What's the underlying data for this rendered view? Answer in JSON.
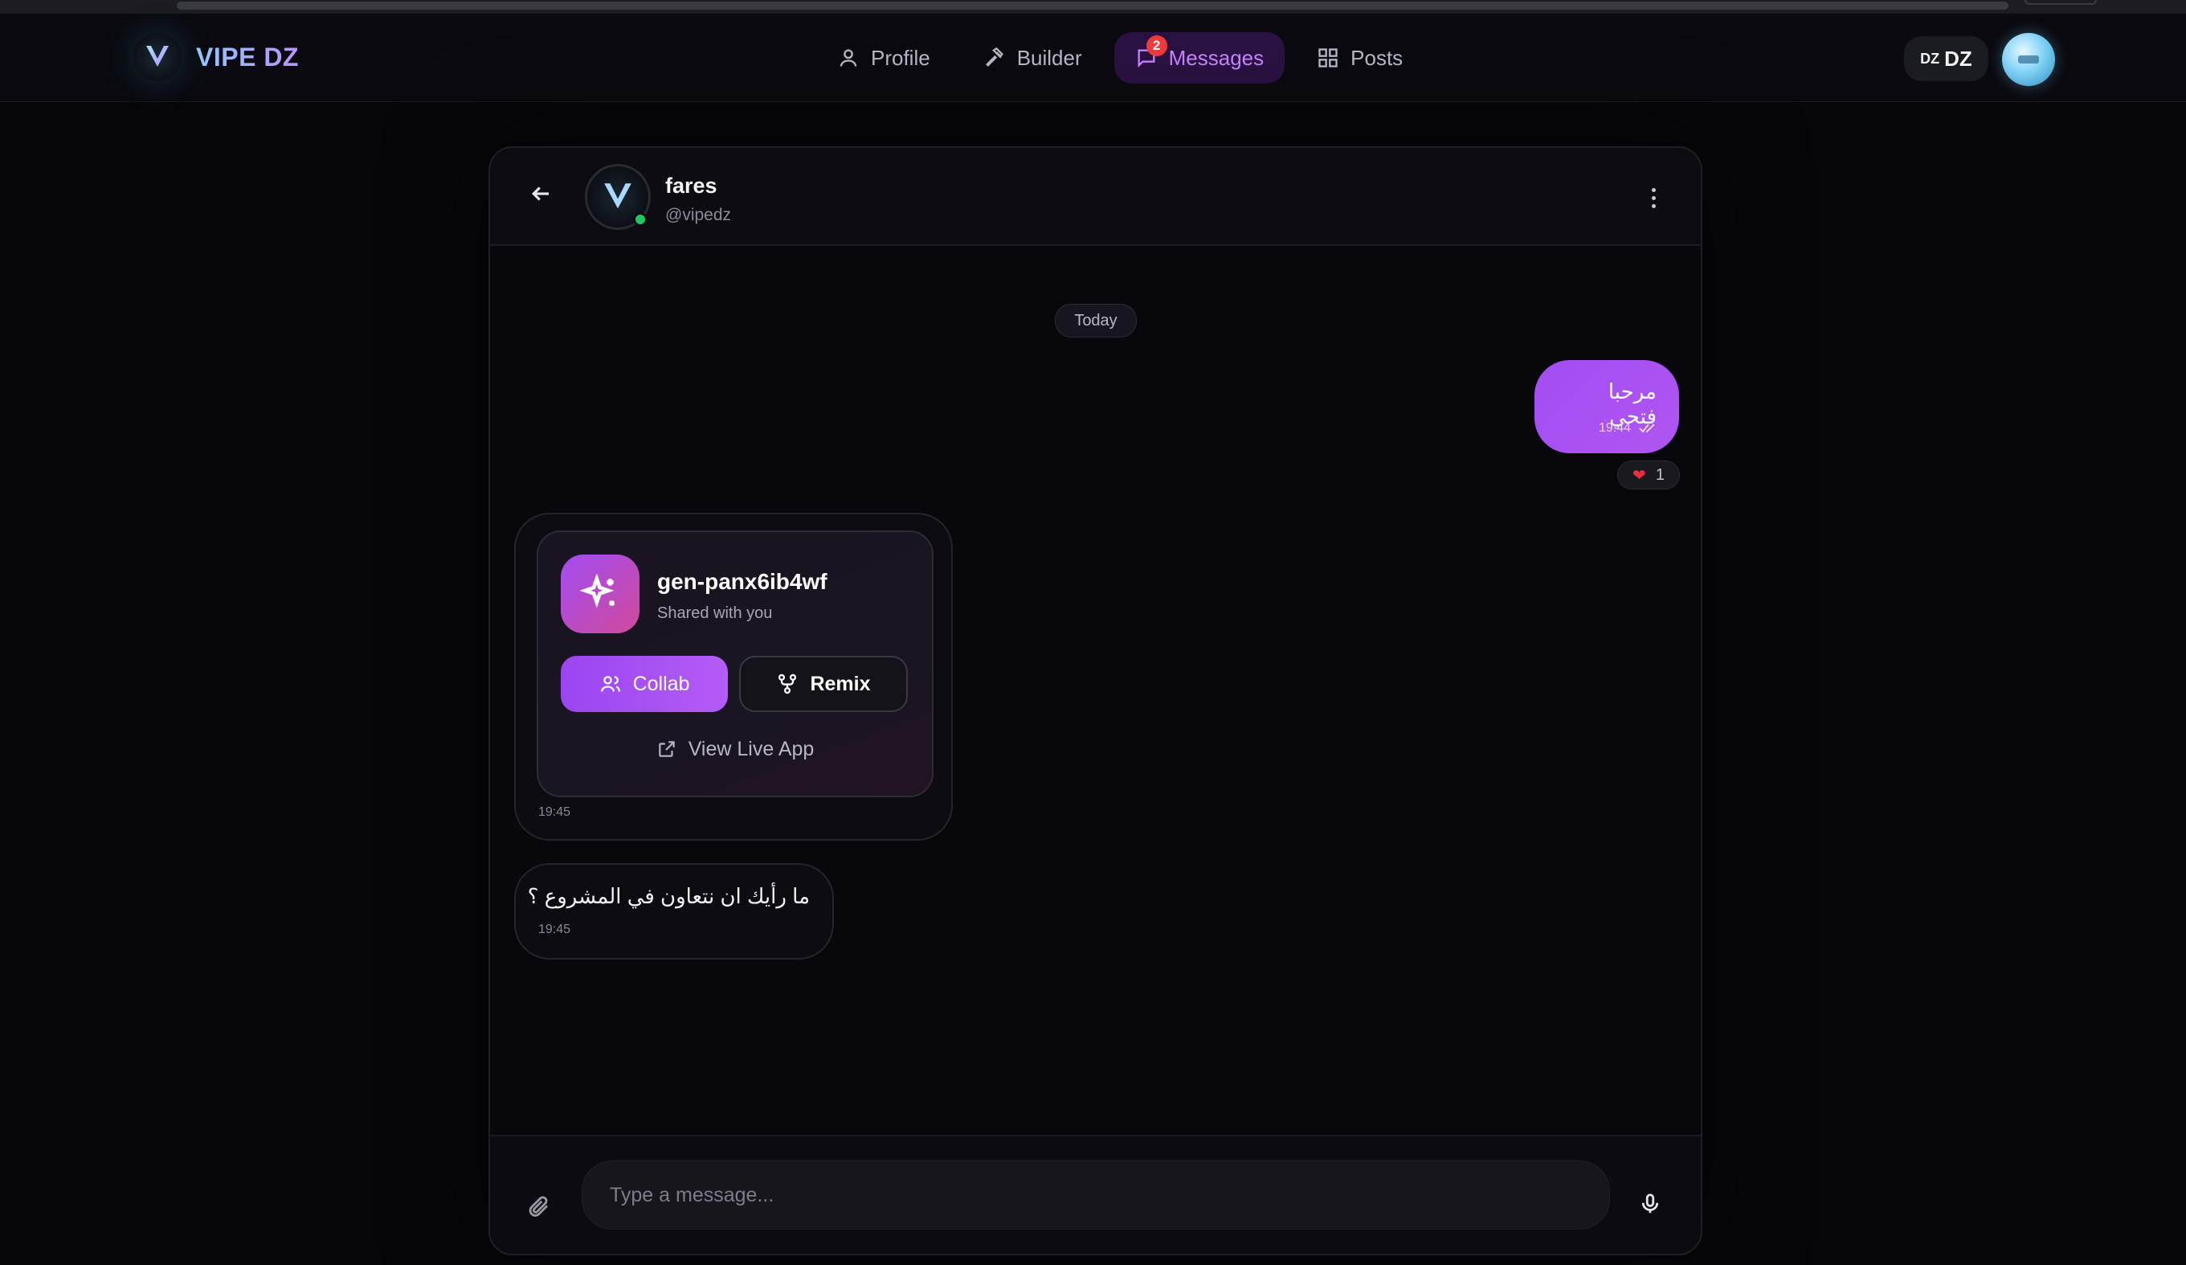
{
  "brand": {
    "name": "VIPE DZ",
    "logo_mark": "V"
  },
  "nav": {
    "items": [
      {
        "label": "Profile",
        "icon": "user-icon"
      },
      {
        "label": "Builder",
        "icon": "hammer-icon"
      },
      {
        "label": "Messages",
        "icon": "message-icon",
        "badge": "2",
        "active": true
      },
      {
        "label": "Posts",
        "icon": "grid-icon"
      }
    ],
    "lang": {
      "code": "DZ",
      "label": "DZ"
    }
  },
  "chat": {
    "contact": {
      "name": "fares",
      "handle": "@vipedz",
      "status": "online"
    },
    "date_separator": "Today",
    "messages": [
      {
        "direction": "outgoing",
        "text": "مرحبا فتحي",
        "time": "19:44",
        "status": "read",
        "reaction": {
          "emoji": "❤",
          "count": "1"
        }
      },
      {
        "direction": "incoming",
        "type": "app-share",
        "app_name": "gen-panx6ib4wf",
        "subtitle": "Shared with you",
        "collab_label": "Collab",
        "remix_label": "Remix",
        "view_label": "View Live App",
        "time": "19:45"
      },
      {
        "direction": "incoming",
        "text": "ما رأيك ان نتعاون في المشروع ؟",
        "time": "19:45"
      }
    ],
    "composer": {
      "placeholder": "Type a message..."
    }
  },
  "colors": {
    "accent": "#a24df5",
    "active_nav_bg": "#2a1242",
    "badge": "#ef3b3b",
    "online": "#22c55e"
  }
}
